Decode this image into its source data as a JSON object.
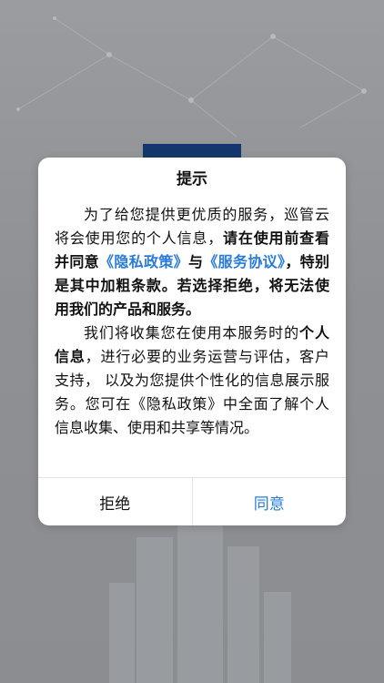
{
  "dialog": {
    "title": "提示",
    "para1": {
      "t1": "为了给您提供更优质的服务，巡管云将会使用您的个人信息，",
      "t2": "请在使用前查看并同意",
      "link_privacy": "《隐私政策》",
      "t3": "与",
      "link_service": "《服务协议》",
      "t4": "，特别是其中加粗条款。若选择拒绝，将无法使用我们的产品和服务。"
    },
    "para2": {
      "t1": "我们将收集您在使用本服务时的",
      "t2": "个人信息",
      "t3": "，进行必要的业务运营与评估，客户支持， 以及为您提供个性化的信息展示服务。您可在《隐私政策》中全面了解个人信息收集、使用和共享等情况。"
    },
    "buttons": {
      "reject": "拒绝",
      "agree": "同意"
    }
  },
  "colors": {
    "link": "#2a7bd8",
    "overlay": "#8d8f93",
    "banner": "#14386e"
  }
}
